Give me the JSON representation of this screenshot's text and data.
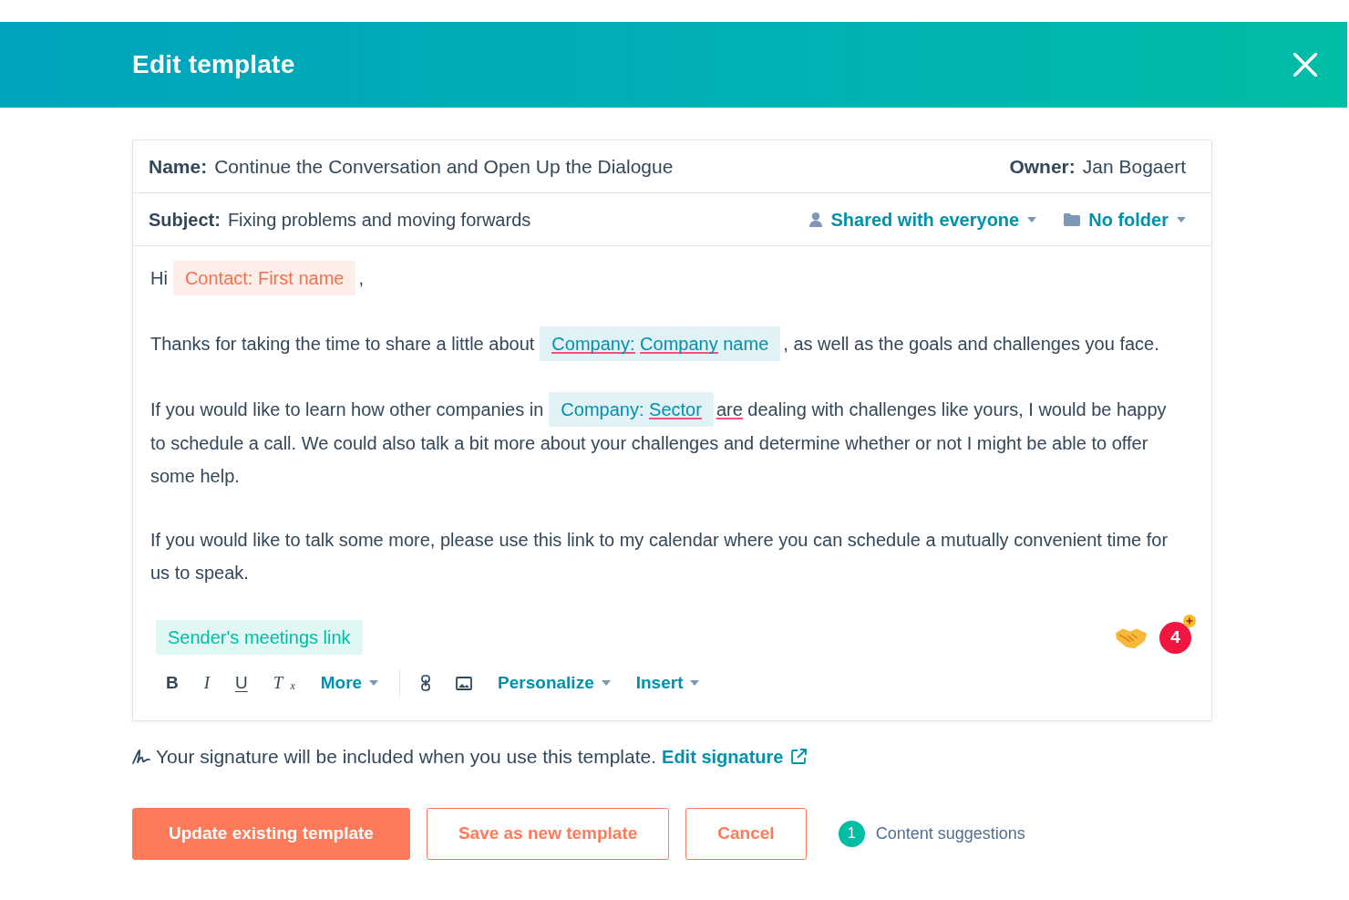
{
  "header": {
    "title": "Edit template"
  },
  "details": {
    "name_label": "Name:",
    "name": "Continue the Conversation and Open Up the Dialogue",
    "owner_label": "Owner:",
    "owner": "Jan Bogaert",
    "subject_label": "Subject:",
    "subject": "Fixing problems and moving forwards",
    "sharing": "Shared with everyone",
    "folder": "No folder"
  },
  "body": {
    "paragraphs": [
      {
        "segments": [
          {
            "kind": "text",
            "text": "Hi",
            "flagged": false
          },
          {
            "kind": "token",
            "color": "#f5704f",
            "words": [
              {
                "text": "Contact:",
                "flagged": false
              },
              {
                "text": "First",
                "flagged": false
              },
              {
                "text": "name",
                "flagged": false
              }
            ]
          },
          {
            "kind": "text",
            "text": ",",
            "flagged": false
          }
        ]
      },
      {
        "segments": [
          {
            "kind": "text",
            "text": "Thanks for taking the time to share a little about",
            "flagged": false
          },
          {
            "kind": "token",
            "color": "#0091ae",
            "words": [
              {
                "text": "Company:",
                "flagged": true
              },
              {
                "text": "Company",
                "flagged": true
              },
              {
                "text": "name",
                "flagged": false
              }
            ]
          },
          {
            "kind": "text",
            "text": ", as well as the goals and challenges you face.",
            "flagged": false
          }
        ]
      },
      {
        "segments": [
          {
            "kind": "text",
            "text": "If you would like to learn how other companies in",
            "flagged": false
          },
          {
            "kind": "token",
            "color": "#0091ae",
            "words": [
              {
                "text": "Company:",
                "flagged": false
              },
              {
                "text": "Sector",
                "flagged": true
              }
            ]
          },
          {
            "kind": "text",
            "text": "are",
            "flagged": true
          },
          {
            "kind": "text",
            "text": "dealing with challenges like yours, I would be happy to schedule a call. We could also talk a bit more about your challenges and determine whether or not I might be able to offer some help.",
            "flagged": false
          }
        ]
      },
      {
        "segments": [
          {
            "kind": "text",
            "text": "If you would like to talk some more, please use this link to my calendar where you can schedule a mutually convenient time for us to speak.",
            "flagged": false
          }
        ]
      },
      {
        "segments": [
          {
            "kind": "token",
            "color": "#00bda5",
            "words": [
              {
                "text": "Sender's",
                "flagged": false
              },
              {
                "text": "meetings",
                "flagged": false
              },
              {
                "text": "link",
                "flagged": false
              }
            ]
          }
        ]
      }
    ],
    "assistant_count": "4"
  },
  "toolbar": {
    "groups": [
      [
        {
          "kind": "bold",
          "label": "B"
        },
        {
          "kind": "italic",
          "label": "I"
        },
        {
          "kind": "underline",
          "label": "U"
        },
        {
          "kind": "clear",
          "label": "T$_{x}$"
        },
        {
          "kind": "menu",
          "label": "More"
        }
      ],
      [
        {
          "kind": "link"
        },
        {
          "kind": "image"
        },
        {
          "kind": "menu",
          "label": "Personalize"
        },
        {
          "kind": "menu",
          "label": "Insert"
        }
      ]
    ]
  },
  "signature": {
    "text": "Your signature will be included when you use this template.",
    "link": "Edit signature"
  },
  "actions": [
    {
      "kind": "primary",
      "label": "Update existing template"
    },
    {
      "kind": "secondary",
      "label": "Save as new template"
    },
    {
      "kind": "secondary",
      "label": "Cancel"
    }
  ],
  "suggestions": {
    "count": "1",
    "label": "Content suggestions"
  }
}
